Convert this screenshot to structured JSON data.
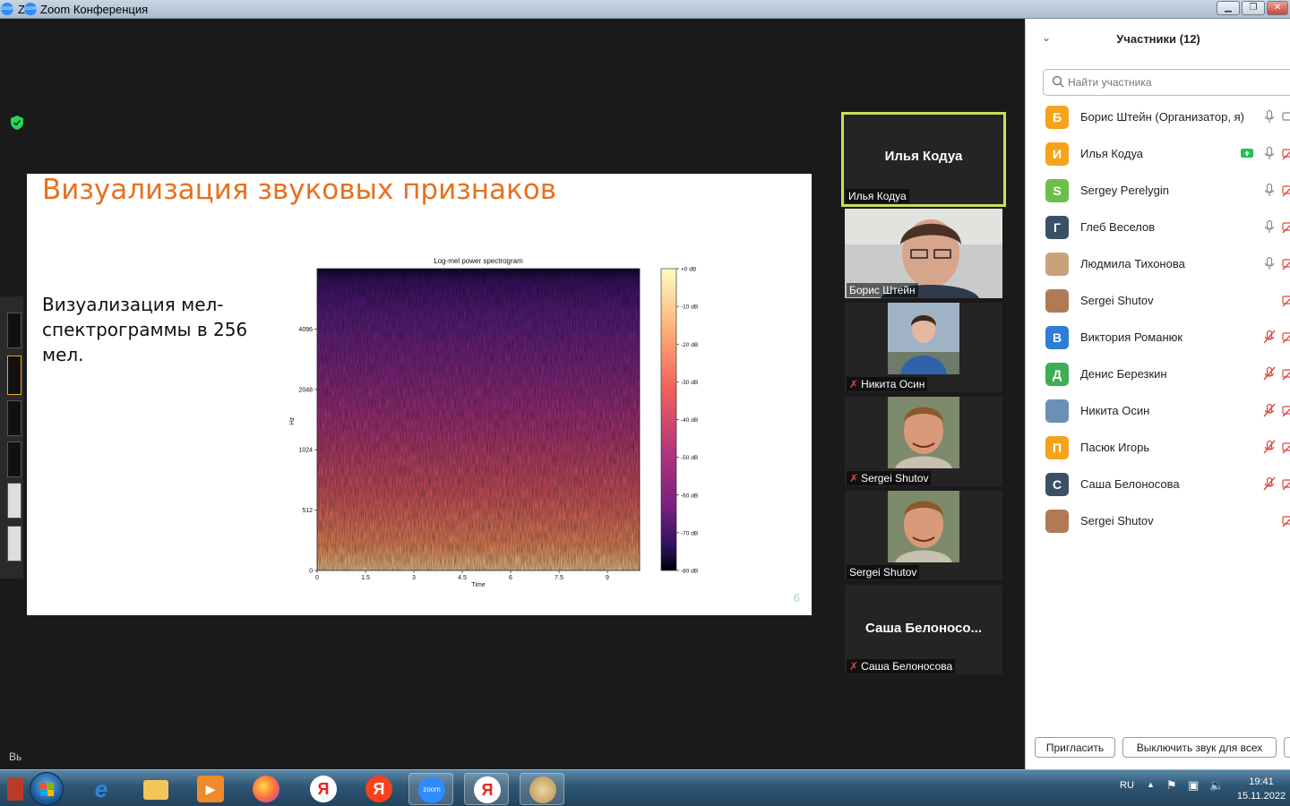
{
  "window": {
    "title": "Zoom Конференция",
    "tab_prefix": "Z"
  },
  "slide": {
    "title": "Визуализация звуковых признаков",
    "body": "Визуализация мел-спектрограммы в 256 мел.",
    "page_number": "6"
  },
  "chart_data": {
    "type": "heatmap",
    "title": "Log-mel power spectrogram",
    "xlabel": "Time",
    "ylabel": "Hz",
    "x_ticks": [
      "0",
      "1.5",
      "3",
      "4.5",
      "6",
      "7.5",
      "9"
    ],
    "y_ticks": [
      "0",
      "512",
      "1024",
      "2048",
      "4096"
    ],
    "colorbar_ticks": [
      "+0 dB",
      "-10 dB",
      "-20 dB",
      "-30 dB",
      "-40 dB",
      "-50 dB",
      "-60 dB",
      "-70 dB",
      "-80 dB"
    ],
    "colormap": "magma",
    "xlim": [
      0,
      10
    ],
    "zlim": [
      -80,
      0
    ]
  },
  "left_strip_text": "Вь",
  "video_tiles": [
    {
      "big_name": "Илья Кодуа",
      "label": "Илья Кодуа",
      "active": true,
      "muted": false,
      "photo": false
    },
    {
      "big_name": "",
      "label": "Борис Штейн",
      "active": false,
      "muted": false,
      "photo": true
    },
    {
      "big_name": "",
      "label": "Никита Осин",
      "active": false,
      "muted": true,
      "photo": true
    },
    {
      "big_name": "",
      "label": "Sergei Shutov",
      "active": false,
      "muted": true,
      "photo": true
    },
    {
      "big_name": "",
      "label": "Sergei Shutov",
      "active": false,
      "muted": false,
      "photo": true
    },
    {
      "big_name": "Саша  Белоносо...",
      "label": "Саша Белоносова",
      "active": false,
      "muted": true,
      "photo": false
    }
  ],
  "participants_panel": {
    "title": "Участники (12)",
    "search_placeholder": "Найти участника",
    "invite_button": "Пригласить",
    "mute_all_button": "Выключить звук для всех",
    "participants": [
      {
        "initial": "Б",
        "name": "Борис Штейн (Организатор, я)",
        "color": "#f5a31a",
        "mic": "on",
        "video": "on",
        "share": false
      },
      {
        "initial": "И",
        "name": "Илья Кодуа",
        "color": "#f5a31a",
        "mic": "on",
        "video": "off",
        "share": true
      },
      {
        "initial": "S",
        "name": "Sergey Perelygin",
        "color": "#6cbf4a",
        "mic": "on",
        "video": "off",
        "share": false
      },
      {
        "initial": "Г",
        "name": "Глеб Веселов",
        "color": "#3b5066",
        "mic": "on",
        "video": "off",
        "share": false
      },
      {
        "initial": "",
        "name": "Людмила Тихонова",
        "color": "#c9a27a",
        "mic": "on",
        "video": "off",
        "share": false
      },
      {
        "initial": "",
        "name": "Sergei Shutov",
        "color": "#b07a56",
        "mic": "none",
        "video": "off",
        "share": false
      },
      {
        "initial": "В",
        "name": "Виктория Романюк",
        "color": "#2e7dd7",
        "mic": "muted",
        "video": "off",
        "share": false
      },
      {
        "initial": "Д",
        "name": "Денис Березкин",
        "color": "#3cae55",
        "mic": "muted",
        "video": "off",
        "share": false
      },
      {
        "initial": "",
        "name": "Никита Осин",
        "color": "#6b8fb5",
        "mic": "muted",
        "video": "off",
        "share": false
      },
      {
        "initial": "П",
        "name": "Пасюк Игорь",
        "color": "#f5a31a",
        "mic": "muted",
        "video": "off",
        "share": false
      },
      {
        "initial": "С",
        "name": "Саша Белоносова",
        "color": "#3b5066",
        "mic": "muted",
        "video": "off",
        "share": false
      },
      {
        "initial": "",
        "name": "Sergei Shutov",
        "color": "#b07a56",
        "mic": "none",
        "video": "off",
        "share": false
      }
    ]
  },
  "taskbar": {
    "language": "RU",
    "time": "19:41",
    "date": "15.11.2022",
    "zoom_label": "zoom",
    "yandex_label": "Я"
  }
}
